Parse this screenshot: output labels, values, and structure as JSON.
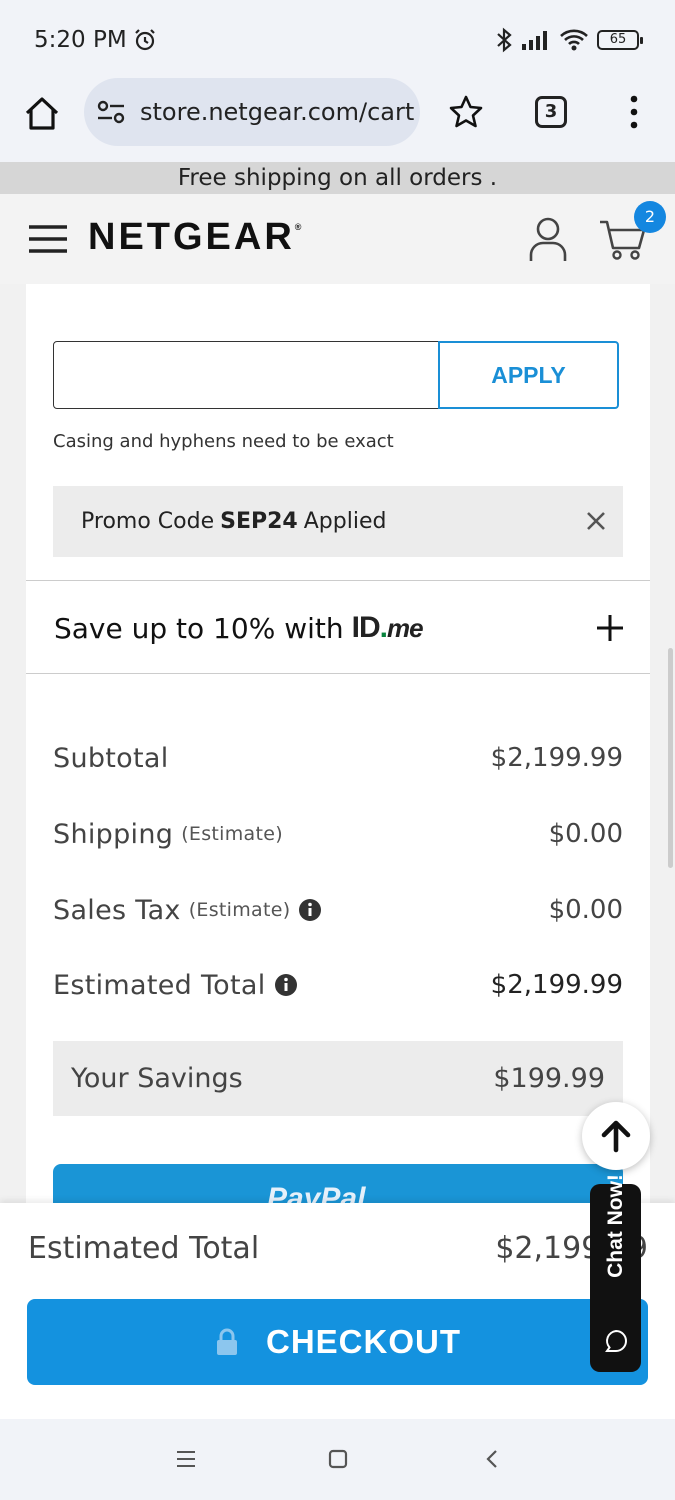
{
  "status_bar": {
    "time": "5:20 PM",
    "battery": "65"
  },
  "browser": {
    "url": "store.netgear.com/cart",
    "tab_count": "3"
  },
  "promo_banner": "Free shipping on all orders .",
  "header": {
    "logo": "NETGEAR",
    "cart_count": "2"
  },
  "coupon": {
    "placeholder": "",
    "apply_label": "APPLY",
    "hint": "Casing and hyphens need to be exact",
    "applied_prefix": "Promo Code",
    "applied_code": "SEP24",
    "applied_suffix": "Applied"
  },
  "idme": {
    "text": "Save up to 10% with",
    "logo_id": "ID",
    "logo_dot": ".",
    "logo_me": "me"
  },
  "summary": {
    "subtotal_label": "Subtotal",
    "subtotal_value": "$2,199.99",
    "shipping_label": "Shipping",
    "shipping_note": "(Estimate)",
    "shipping_value": "$0.00",
    "tax_label": "Sales Tax",
    "tax_note": "(Estimate)",
    "tax_value": "$0.00",
    "total_label": "Estimated Total",
    "total_value": "$2,199.99",
    "savings_label": "Your Savings",
    "savings_value": "$199.99"
  },
  "paypal_label": "PayPal",
  "sticky": {
    "total_label": "Estimated Total",
    "total_value": "$2,199.99",
    "checkout_label": "CHECKOUT"
  },
  "chat_label": "Chat Now!",
  "colors": {
    "accent": "#1492df",
    "badge": "#1487e0",
    "idme_dot": "#08833d"
  }
}
